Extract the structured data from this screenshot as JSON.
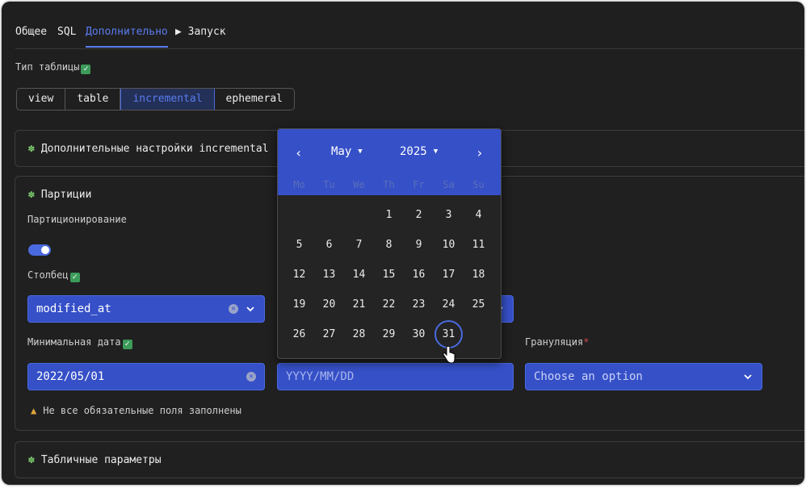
{
  "tabs": [
    {
      "label": "Общее",
      "active": false
    },
    {
      "label": "SQL",
      "active": false
    },
    {
      "label": "Дополнительно",
      "active": true
    },
    {
      "label": "▶ Запуск",
      "active": false
    }
  ],
  "table_type": {
    "label": "Тип таблицы",
    "options": [
      "view",
      "table",
      "incremental",
      "ephemeral"
    ],
    "selected": "incremental"
  },
  "incremental_panel": {
    "title": "Дополнительные настройки incremental"
  },
  "partitions": {
    "title": "Партиции",
    "partitioning_label": "Партиционирование",
    "partitioning_on": true,
    "column_label": "Столбец",
    "column_value": "modified_at",
    "min_date_label": "Минимальная дата",
    "min_date_value": "2022/05/01",
    "max_date_placeholder": "YYYY/MM/DD",
    "granularity_label": "Грануляция",
    "granularity_required_mark": "*",
    "granularity_placeholder": "Choose an option",
    "warning": "Не все обязательные поля заполнены"
  },
  "table_params_panel": {
    "title": "Табличные параметры"
  },
  "calendar": {
    "month": "May",
    "year": "2025",
    "weekdays": [
      "Mo",
      "Tu",
      "We",
      "Th",
      "Fr",
      "Sa",
      "Su"
    ],
    "first_weekday_index": 3,
    "days_in_month": 31,
    "highlighted_day": 31
  },
  "colors": {
    "accent": "#3650c8",
    "accent_text": "#5b7cf0",
    "check": "#3c9b5a",
    "warning": "#e0a53a"
  }
}
